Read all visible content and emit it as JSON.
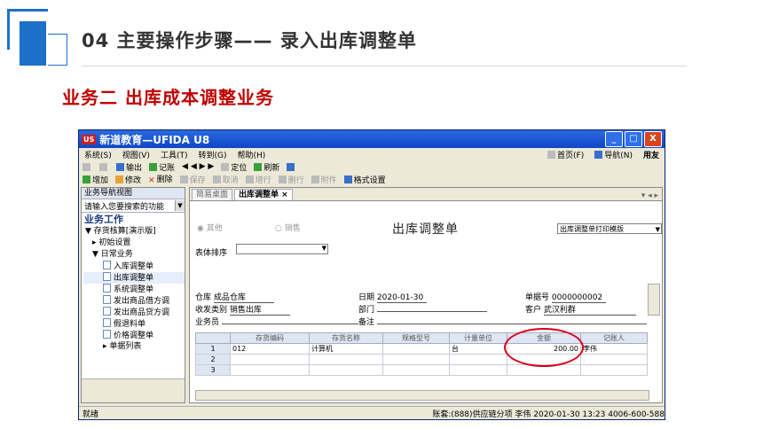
{
  "slide": {
    "title": "04  主要操作步骤—— 录入出库调整单",
    "subtitle": "业务二  出库成本调整业务"
  },
  "window": {
    "logo": "US",
    "title": "新道教育—UFIDA U8",
    "controls": [
      "_",
      "□",
      "X"
    ]
  },
  "menubar": {
    "items": [
      "系统(S)",
      "视图(V)",
      "工具(T)",
      "转到(G)",
      "帮助(H)"
    ],
    "right": [
      "首页(F)",
      "导航(N)"
    ],
    "brand": "用友"
  },
  "toolbar1": {
    "items": [
      "输出",
      "记账",
      "定位",
      "刷新"
    ]
  },
  "toolbar2": {
    "items": [
      {
        "label": "增加",
        "enabled": true
      },
      {
        "label": "修改",
        "enabled": true
      },
      {
        "label": "删除",
        "enabled": true
      },
      {
        "label": "保存",
        "enabled": false
      },
      {
        "label": "取消",
        "enabled": false
      },
      {
        "label": "增行",
        "enabled": false
      },
      {
        "label": "删行",
        "enabled": false
      },
      {
        "label": "附件",
        "enabled": false
      },
      {
        "label": "格式设置",
        "enabled": true
      }
    ]
  },
  "nav": {
    "header": "业务导航视图",
    "search_placeholder": "请输入您要搜索的功能",
    "section": "业务工作",
    "tree": [
      {
        "label": "存货核算[演示版]",
        "level": 0,
        "prefix": "▼"
      },
      {
        "label": "初始设置",
        "level": 1,
        "prefix": "▸"
      },
      {
        "label": "日常业务",
        "level": 1,
        "prefix": "▼"
      },
      {
        "label": "入库调整单",
        "level": 2
      },
      {
        "label": "出库调整单",
        "level": 2,
        "selected": true
      },
      {
        "label": "系统调整单",
        "level": 2
      },
      {
        "label": "发出商品借方调",
        "level": 2
      },
      {
        "label": "发出商品贷方调",
        "level": 2
      },
      {
        "label": "假退料单",
        "level": 2
      },
      {
        "label": "价格调整单",
        "level": 2
      },
      {
        "label": "单据列表",
        "level": 2,
        "prefix": "▸"
      }
    ]
  },
  "tabs": [
    {
      "label": "简易桌面",
      "active": false
    },
    {
      "label": "出库调整单 ×",
      "active": true
    }
  ],
  "form": {
    "title": "出库调整单",
    "radio_other": "◉ 其他",
    "radio_sales": "○ 销售",
    "print_template": "出库调整单打印模版",
    "sort_label": "表体排序",
    "warehouse_label": "仓库",
    "warehouse": "成品仓库",
    "date_label": "日期",
    "date": "2020-01-30",
    "doc_no_label": "单据号",
    "doc_no": "0000000002",
    "receive_type_label": "收发类别",
    "receive_type": "销售出库",
    "dept_label": "部门",
    "dept": "",
    "customer_label": "客户",
    "customer": "武汉利群",
    "salesman_label": "业务员",
    "salesman": "",
    "remark_label": "备注",
    "remark": ""
  },
  "grid": {
    "columns": [
      "",
      "存货编码",
      "存货名称",
      "规格型号",
      "计量单位",
      "金额",
      "记账人"
    ],
    "rows": [
      [
        "1",
        "012",
        "计算机",
        "",
        "台",
        "200.00",
        "李伟"
      ],
      [
        "2",
        "",
        "",
        "",
        "",
        "",
        ""
      ],
      [
        "3",
        "",
        "",
        "",
        "",
        "",
        ""
      ]
    ]
  },
  "status": {
    "left": "就绪",
    "right": "账套:(888)供应链分项  李伟  2020-01-30 13:23  4006-600-588"
  },
  "colors": {
    "accent_blue": "#1e6fc7",
    "subtitle_red": "#c00000",
    "highlight_ellipse": "#d9001b"
  }
}
